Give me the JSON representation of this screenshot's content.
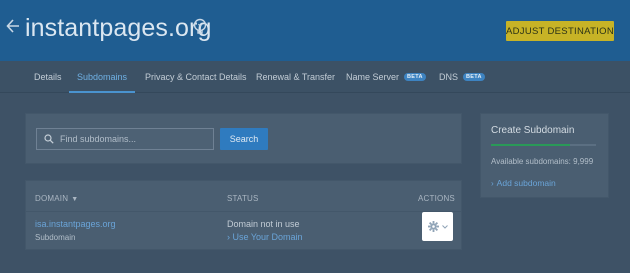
{
  "header": {
    "back_icon": "arrow-left-icon",
    "domain_name": "instantpages.org",
    "info_icon": "lightbulb-icon",
    "adjust_button": "ADJUST DESTINATION",
    "adjust_color": "#c7b326"
  },
  "tabs": [
    {
      "label": "Details",
      "active": false
    },
    {
      "label": "Subdomains",
      "active": true
    },
    {
      "label": "Privacy & Contact Details",
      "active": false
    },
    {
      "label": "Renewal & Transfer",
      "active": false
    },
    {
      "label": "Name Server",
      "active": false,
      "badge": "BETA"
    },
    {
      "label": "DNS",
      "active": false,
      "badge": "BETA"
    }
  ],
  "search": {
    "placeholder": "Find subdomains...",
    "value": "",
    "button": "Search"
  },
  "table": {
    "columns": {
      "domain": "DOMAIN",
      "status": "STATUS",
      "actions": "ACTIONS"
    },
    "rows": [
      {
        "domain": "isa.instantpages.org",
        "type": "Subdomain",
        "status": "Domain not in use",
        "status_link": "Use Your Domain",
        "action_icon": "gear-icon"
      }
    ]
  },
  "create": {
    "title": "Create Subdomain",
    "available": "Available subdomains: 9,999",
    "add_link": "Add subdomain"
  }
}
